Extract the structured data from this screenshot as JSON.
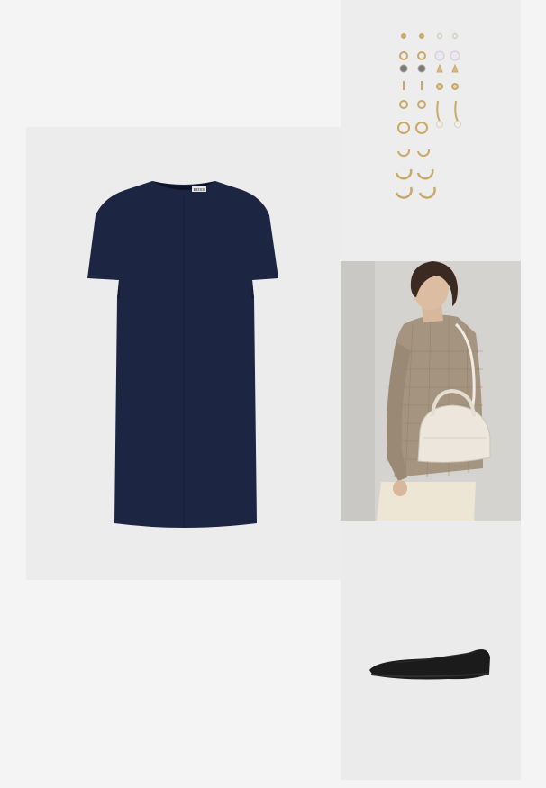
{
  "outfit": {
    "items": [
      {
        "id": "dress",
        "kind": "navy short-sleeve shift dress",
        "brand_label": "BOSS",
        "colors": {
          "fabric": "#1c2542"
        }
      },
      {
        "id": "earrings",
        "kind": "gold earring set",
        "colors": {
          "metal": "#c9a96a",
          "pearl": "#f2efe8"
        }
      },
      {
        "id": "bag",
        "kind": "model with cream handbag and check blazer",
        "colors": {
          "bag": "#ece6dc",
          "blazer": "#a59580"
        }
      },
      {
        "id": "flats",
        "kind": "black pointed ballet flats",
        "colors": {
          "leather": "#1b1b1b"
        }
      }
    ]
  }
}
